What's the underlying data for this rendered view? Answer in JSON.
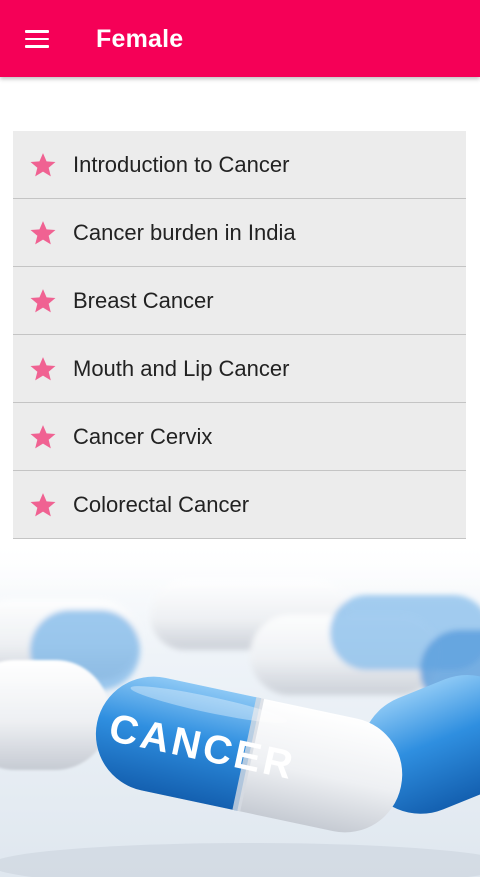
{
  "app_bar": {
    "title": "Female",
    "menu_icon": "hamburger-menu-icon",
    "color": "#f50057"
  },
  "topics": [
    {
      "label": "Introduction to Cancer",
      "icon": "star-icon"
    },
    {
      "label": "Cancer burden in India",
      "icon": "star-icon"
    },
    {
      "label": "Breast Cancer",
      "icon": "star-icon"
    },
    {
      "label": "Mouth and Lip Cancer",
      "icon": "star-icon"
    },
    {
      "label": "Cancer Cervix",
      "icon": "star-icon"
    },
    {
      "label": "Colorectal Cancer",
      "icon": "star-icon"
    }
  ],
  "star_color": "#f06292",
  "list_background": "#ececec",
  "banner": {
    "capsule_text": "CANCER",
    "capsule_color": "#1e88e5"
  }
}
